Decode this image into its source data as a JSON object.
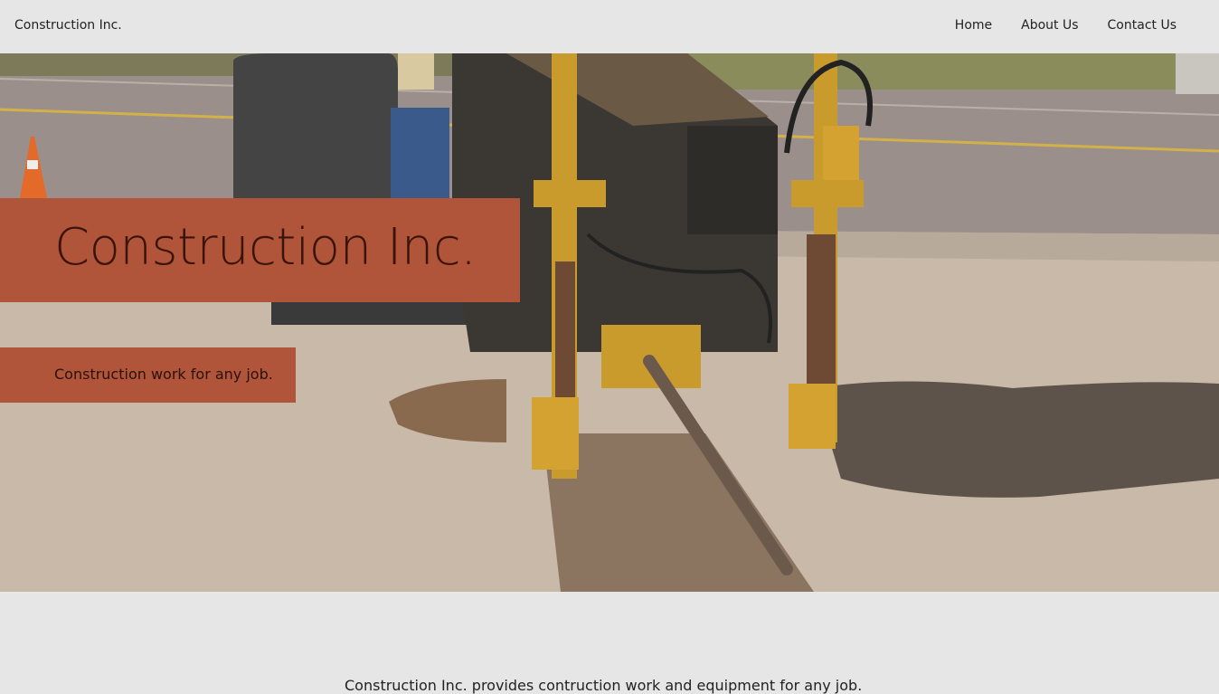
{
  "nav": {
    "brand": "Construction Inc.",
    "links": [
      "Home",
      "About Us",
      "Contact Us"
    ]
  },
  "hero": {
    "title": "Construction Inc.",
    "subtitle": "Construction work for any job.",
    "accent_color": "#b0543a"
  },
  "intro": {
    "text": "Construction Inc. provides contruction work and equipment for any job."
  }
}
